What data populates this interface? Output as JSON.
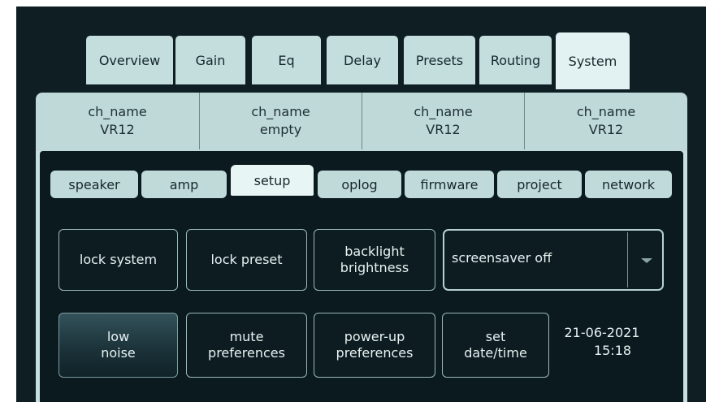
{
  "tabs": [
    {
      "label": "Overview"
    },
    {
      "label": "Gain"
    },
    {
      "label": "Eq"
    },
    {
      "label": "Delay"
    },
    {
      "label": "Presets"
    },
    {
      "label": "Routing"
    },
    {
      "label": "System"
    }
  ],
  "active_tab": "System",
  "channels": [
    {
      "name": "ch_name",
      "model": "VR12"
    },
    {
      "name": "ch_name",
      "model": "empty"
    },
    {
      "name": "ch_name",
      "model": "VR12"
    },
    {
      "name": "ch_name",
      "model": "VR12"
    }
  ],
  "subtabs": [
    {
      "label": "speaker"
    },
    {
      "label": "amp"
    },
    {
      "label": "setup"
    },
    {
      "label": "oplog"
    },
    {
      "label": "firmware"
    },
    {
      "label": "project"
    },
    {
      "label": "network"
    }
  ],
  "active_subtab": "setup",
  "buttons": {
    "lock_system": "lock system",
    "lock_preset": "lock preset",
    "backlight_1": "backlight",
    "backlight_2": "brightness",
    "low_noise_1": "low",
    "low_noise_2": "noise",
    "mute_1": "mute",
    "mute_2": "preferences",
    "powerup_1": "power-up",
    "powerup_2": "preferences",
    "setdate_1": "set",
    "setdate_2": "date/time"
  },
  "screensaver": {
    "value": "screensaver off"
  },
  "datetime": {
    "date": "21-06-2021",
    "time": "15:18"
  },
  "colors": {
    "background": "#0f1e23",
    "tab": "#c3dedd",
    "active_tab": "#e2f2f2",
    "button_border": "#9cb9b9"
  }
}
